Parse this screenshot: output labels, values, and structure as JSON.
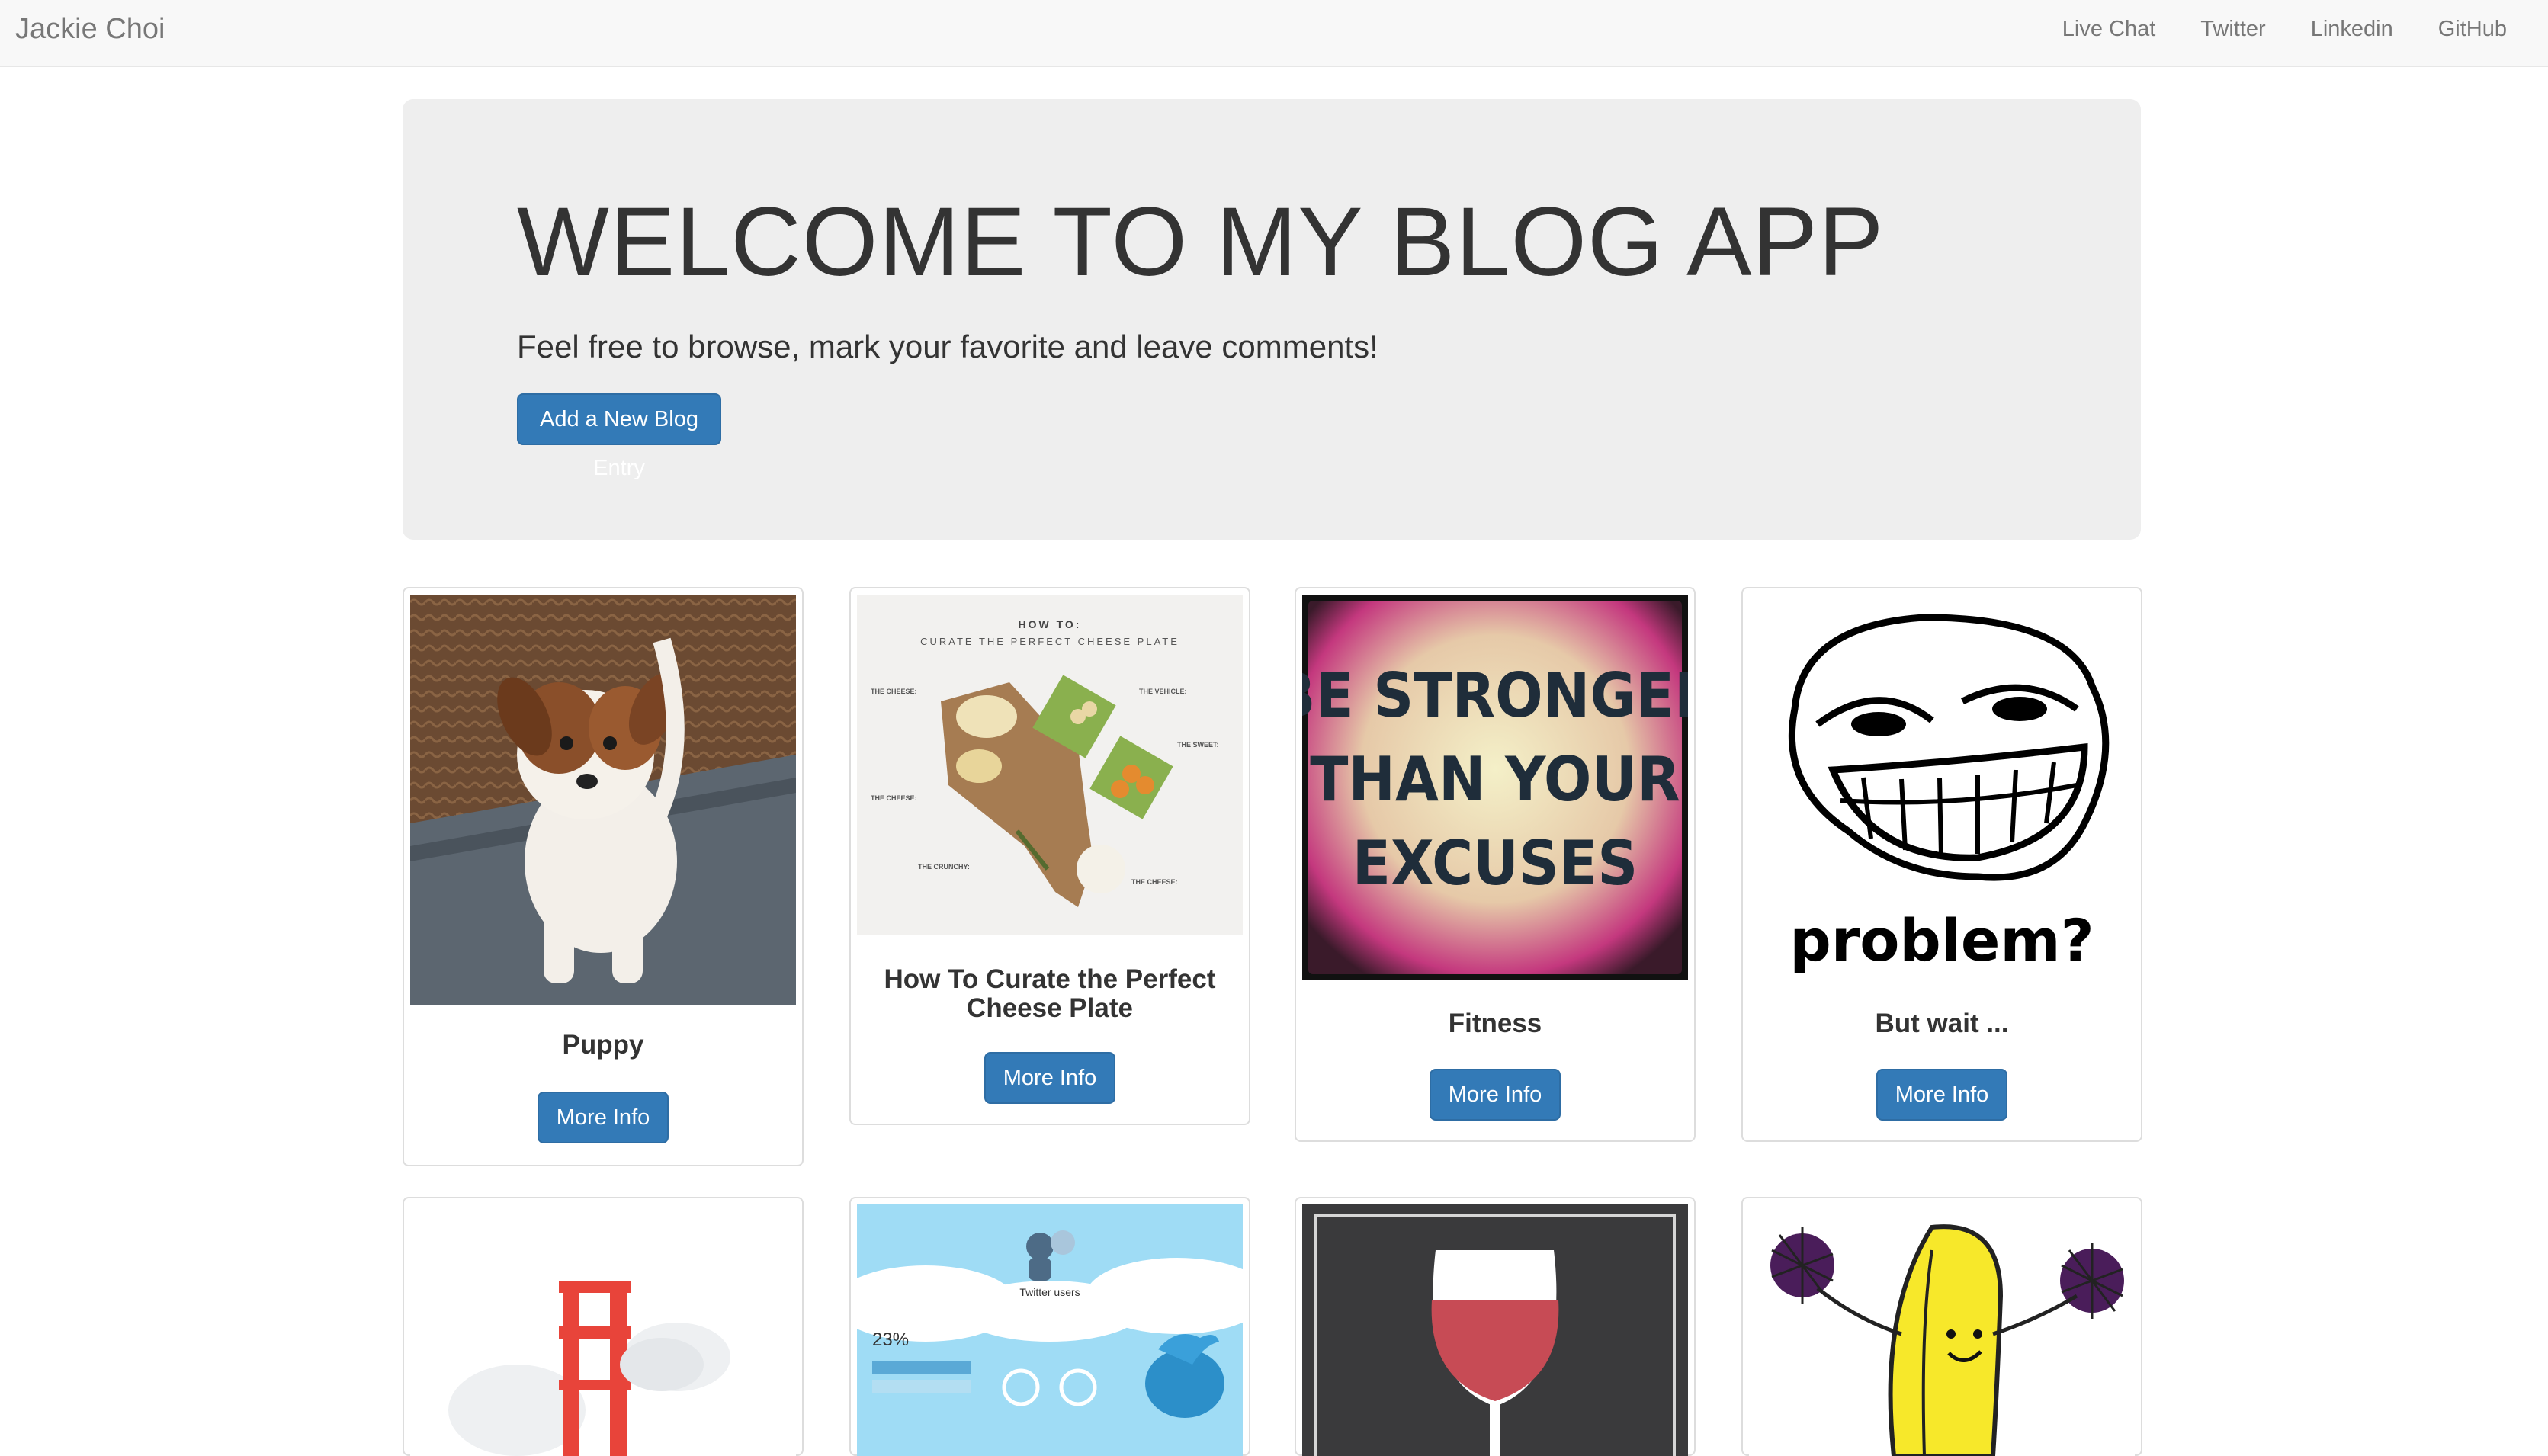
{
  "navbar": {
    "brand": "Jackie Choi",
    "links": [
      "Live Chat",
      "Twitter",
      "Linkedin",
      "GitHub"
    ]
  },
  "jumbotron": {
    "title": "WELCOME TO MY BLOG APP",
    "subtitle": "Feel free to browse, mark your favorite and leave comments!",
    "button_label": "Add a New Blog Entry"
  },
  "posts": [
    {
      "title": "Puppy",
      "button_label": "More Info",
      "image": "puppy-photo"
    },
    {
      "title": "How To Curate the Perfect Cheese Plate",
      "button_label": "More Info",
      "image": "cheese-plate-infographic",
      "image_text": {
        "heading": "HOW TO:",
        "subheading": "CURATE THE PERFECT CHEESE PLATE",
        "label_1": "THE CHEESE:",
        "label_2": "THE VEHICLE:",
        "label_3": "THE SWEET:",
        "label_4": "THE CHEESE:",
        "label_5": "THE CRUNCHY:",
        "label_6": "THE CHEESE:"
      }
    },
    {
      "title": "Fitness",
      "button_label": "More Info",
      "image": "motivational-poster",
      "image_text": {
        "line_1": "BE STRONGER",
        "line_2": "THAN YOUR",
        "line_3": "EXCUSES"
      }
    },
    {
      "title": "But wait ...",
      "button_label": "More Info",
      "image": "trollface-meme",
      "image_text": {
        "caption": "problem?"
      }
    },
    {
      "title": "",
      "button_label": "",
      "image": "golden-gate-bridge-illustration"
    },
    {
      "title": "",
      "button_label": "",
      "image": "twitter-users-infographic",
      "image_text": {
        "heading": "Twitter users",
        "stat": "23%"
      }
    },
    {
      "title": "",
      "button_label": "",
      "image": "wine-glass-chalkboard"
    },
    {
      "title": "",
      "button_label": "",
      "image": "dancing-banana-cheerleader"
    }
  ],
  "colors": {
    "primary": "#337ab7",
    "navbar_bg": "#f8f8f8",
    "jumbotron_bg": "#eeeeee"
  }
}
